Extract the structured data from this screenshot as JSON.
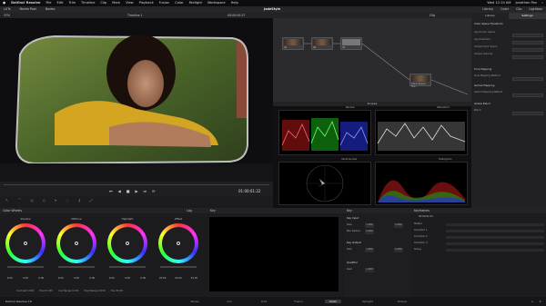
{
  "menubar": {
    "items": [
      "DaVinci Resolve",
      "File",
      "Edit",
      "Trim",
      "Timeline",
      "Clip",
      "Mark",
      "View",
      "Playback",
      "Fusion",
      "Color",
      "Fairlight",
      "Workspace",
      "Help"
    ],
    "right": [
      "Wed 12:10 AM",
      "Jonathan Pan"
    ]
  },
  "toolbar": {
    "left": [
      "LUTs",
      "Media Pool",
      "Nodes"
    ],
    "project": "JadeStyle",
    "right": [
      "Library",
      "Color",
      "Clip",
      "Lightbox",
      "Inspector",
      "Effects"
    ]
  },
  "viewer": {
    "zoom": "37%",
    "timeline": "Timeline 1",
    "timecode_top": "00:00:00:27",
    "timecode": "01:00:01:22"
  },
  "nodes": {
    "header": "Clip",
    "items": [
      "01",
      "02",
      "03",
      "04"
    ],
    "name_label": "Color Space Tra..."
  },
  "scopes": {
    "header": "Scopes",
    "parade": "Parade",
    "waveform": "Waveform",
    "vectorscope": "Vectorscope",
    "histogram": "Histogram"
  },
  "inspector": {
    "tabs": [
      "Library",
      "Settings"
    ],
    "title": "Color Space Transform",
    "rows": [
      "Input Color Space",
      "Input Gamma",
      "Output Color Space",
      "Output Gamma"
    ],
    "section2": "Tone Mapping",
    "section3": "Gamut Mapping",
    "rows2": [
      "Tone Mapping Method",
      "Gamut Mapping Method"
    ],
    "section4": "Global Blend",
    "blend": "Blend"
  },
  "color_wheels": {
    "header": "Color Wheels",
    "mode": "Log",
    "wheels": [
      {
        "name": "Shadow",
        "v1": "0.00",
        "v2": "0.00",
        "v3": "0.00"
      },
      {
        "name": "Midtone",
        "v1": "0.00",
        "v2": "0.00",
        "v3": "0.00"
      },
      {
        "name": "Highlight",
        "v1": "0.00",
        "v2": "0.00",
        "v3": "0.00"
      },
      {
        "name": "Offset",
        "v1": "25.00",
        "v2": "25.00",
        "v3": "25.00"
      }
    ],
    "footer": [
      "Contrast 1.000",
      "Pivot 0.435",
      "Low Range 0.333",
      "High Range 0.550",
      "Hue 50.00"
    ]
  },
  "curves": {
    "header": "Key"
  },
  "qualifier": {
    "header": "Key",
    "section1": "Key Input",
    "section2": "Key Output",
    "section3": "Qualifier",
    "gain_label": "Gain",
    "offset_label": "Offset",
    "clean_label": "Blur Radius",
    "gain": "1.000",
    "offset": "0.000"
  },
  "keyframes": {
    "header": "Keyframes",
    "timecode": "00:00:01:02",
    "rows": [
      "Master",
      "Corrector 1",
      "Corrector 2",
      "Corrector 3",
      "Sizing"
    ]
  },
  "pagenav": {
    "brand": "DaVinci Resolve 16",
    "pages": [
      "Media",
      "Cut",
      "Edit",
      "Fusion",
      "Color",
      "Fairlight",
      "Deliver"
    ],
    "active": "Color"
  }
}
